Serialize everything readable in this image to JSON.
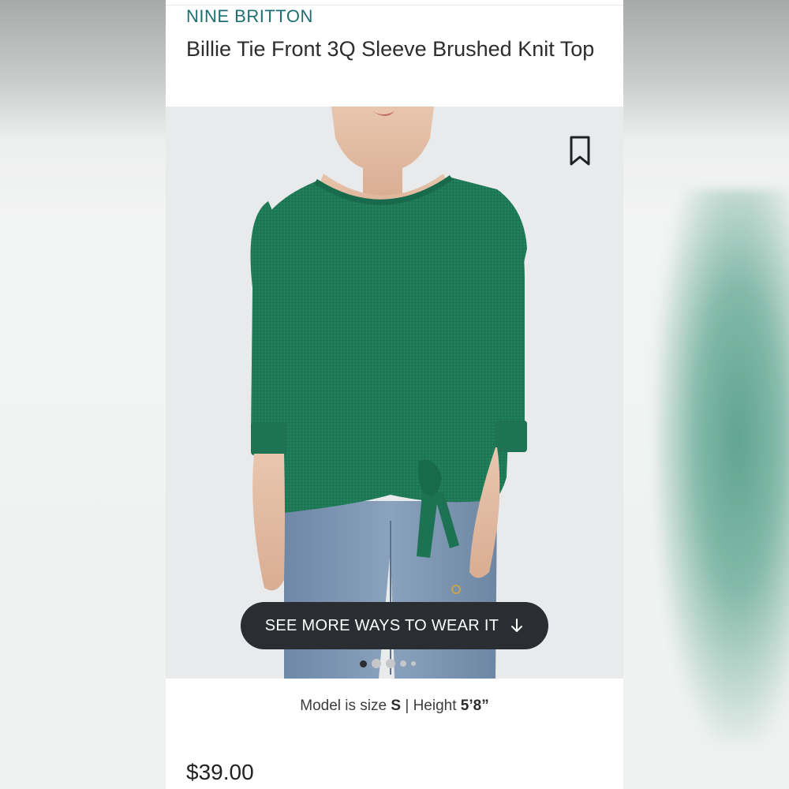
{
  "product": {
    "brand": "NINE BRITTON",
    "title": "Billie Tie Front 3Q Sleeve Brushed Knit Top",
    "price": "$39.00"
  },
  "gallery": {
    "cta_label": "SEE MORE WAYS TO WEAR IT",
    "cta_icon": "arrow-down-icon",
    "bookmark_icon": "bookmark-icon",
    "dot_count": 5,
    "active_dot": 1
  },
  "model_info": {
    "prefix": "Model is size ",
    "size": "S",
    "separator": " | ",
    "height_label": "Height ",
    "height": "5’8”"
  },
  "colors": {
    "brand": "#1f6f72",
    "top_green": "#1f7a58",
    "denim": "#7d97b3",
    "cta_bg": "#2a2d31"
  }
}
